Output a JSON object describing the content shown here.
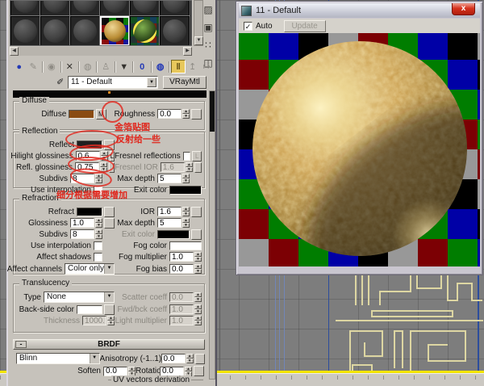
{
  "annotation_color": "#e0281e",
  "viewport": {
    "bg": "#7d7d7d",
    "spline_color": "#ddd6a2",
    "yellow_line": "#f2e400",
    "blue_line_soft": "#7186b8",
    "blue_line_strong": "#2c4d9c"
  },
  "material_editor": {
    "slots": {
      "cols": 6,
      "rows": 2,
      "active_index": 9,
      "gold_index": 9,
      "textured_index": 10
    },
    "side_icons": [
      {
        "name": "sample-uv-tiling-icon",
        "glyph": "▨"
      },
      {
        "name": "video-color-check-icon",
        "glyph": "▣"
      },
      {
        "name": "options-icon",
        "glyph": "∷"
      },
      {
        "name": "material-map-navigator-icon",
        "glyph": "◫"
      }
    ],
    "toolbar": [
      {
        "name": "get-material-button",
        "glyph": "●",
        "state": "blue"
      },
      {
        "name": "put-material-to-scene-button",
        "glyph": "✎",
        "state": "dim",
        "sep_after": true
      },
      {
        "name": "assign-material-to-selection-button",
        "glyph": "◉",
        "state": "dim",
        "sep_after": true
      },
      {
        "name": "reset-map-mtl-button",
        "glyph": "✕",
        "state": "",
        "sep_after": true
      },
      {
        "name": "make-material-copy-button",
        "glyph": "◍",
        "state": "dim",
        "sep_after": true
      },
      {
        "name": "make-unique-button",
        "glyph": "♙",
        "state": "dim",
        "sep_after": true
      },
      {
        "name": "put-to-library-button",
        "glyph": "▼",
        "state": "",
        "sep_after": true
      },
      {
        "name": "material-id-channel-button",
        "glyph": "0",
        "state": "blue",
        "sep_after": true
      },
      {
        "name": "show-map-in-viewport-button",
        "glyph": "◍",
        "state": "blue",
        "sep_after": true
      },
      {
        "name": "show-end-result-button",
        "glyph": "‖",
        "state": "active"
      },
      {
        "name": "go-to-parent-button",
        "glyph": "↥",
        "state": "dim"
      },
      {
        "name": "go-forward-sibling-button",
        "glyph": "↦",
        "state": "dim"
      }
    ],
    "name_row": {
      "material_name": "11 - Default",
      "class_button": "VRayMtl"
    },
    "diffuse": {
      "title": "Diffuse",
      "label": "Diffuse",
      "swatch": "#8a4b12",
      "map_button": "M",
      "roughness_label": "Roughness",
      "roughness": "0.0"
    },
    "reflection": {
      "title": "Reflection",
      "reflect_label": "Reflect",
      "reflect_swatch": "#1f1f1f",
      "hilight_label": "Hilight glossiness",
      "hilight": "0.6",
      "lock1": "L",
      "fresnel_label": "Fresnel reflections",
      "lock2": "L",
      "refl_gloss_label": "Refl. glossiness",
      "refl_gloss": "0.75",
      "fresnel_ior_label": "Fresnel IOR",
      "fresnel_ior": "1.6",
      "subdivs_label": "Subdivs",
      "subdivs": "8",
      "max_depth_label": "Max depth",
      "max_depth": "5",
      "interp_label": "Use interpolation",
      "exit_label": "Exit color",
      "exit_swatch": "#000000"
    },
    "refraction": {
      "title": "Refraction",
      "refract_label": "Refract",
      "refract_swatch": "#000000",
      "gloss_label": "Glossiness",
      "gloss": "1.0",
      "subdivs_label": "Subdivs",
      "subdivs": "8",
      "interp_label": "Use interpolation",
      "shadows_label": "Affect shadows",
      "channels_label": "Affect channels",
      "channels_value": "Color only",
      "ior_label": "IOR",
      "ior": "1.6",
      "max_depth_label": "Max depth",
      "max_depth": "5",
      "exit_label": "Exit color",
      "exit_swatch": "#000000",
      "fog_color_label": "Fog color",
      "fog_swatch": "#ffffff",
      "fog_mult_label": "Fog multiplier",
      "fog_mult": "1.0",
      "fog_bias_label": "Fog bias",
      "fog_bias": "0.0"
    },
    "translucency": {
      "title": "Translucency",
      "type_label": "Type",
      "type_value": "None",
      "back_label": "Back-side color",
      "back_swatch": "#ffffff",
      "thickness_label": "Thickness",
      "thickness": "1000.0",
      "scatter_label": "Scatter coeff",
      "scatter": "0.0",
      "fwd_label": "Fwd/bck coeff",
      "fwd": "1.0",
      "light_label": "Light multiplier",
      "light_mult": "1.0"
    },
    "brdf": {
      "title": "BRDF",
      "collapse": "-",
      "type_value": "Blinn",
      "soften_label": "Soften",
      "soften": "0.0",
      "aniso_label": "Anisotropy (-1..1)",
      "aniso": "0.0",
      "rot_label": "Rotation",
      "rotation": "0.0",
      "uv_group": "UV vectors derivation"
    },
    "annotations": {
      "map_note": "金箔贴图",
      "reflect_note": "反射给一些",
      "subdiv_note": "细分根据需要增加"
    }
  },
  "preview_window": {
    "title": "11 - Default",
    "auto_label": "Auto",
    "auto_checked": "✓",
    "update_label": "Update",
    "close_glyph": "x",
    "checker": {
      "palette": [
        "#007d00",
        "#0000a6",
        "#000000",
        "#989898",
        "#7c0004"
      ],
      "cols": 9,
      "rows": 9,
      "tile": 37
    }
  }
}
